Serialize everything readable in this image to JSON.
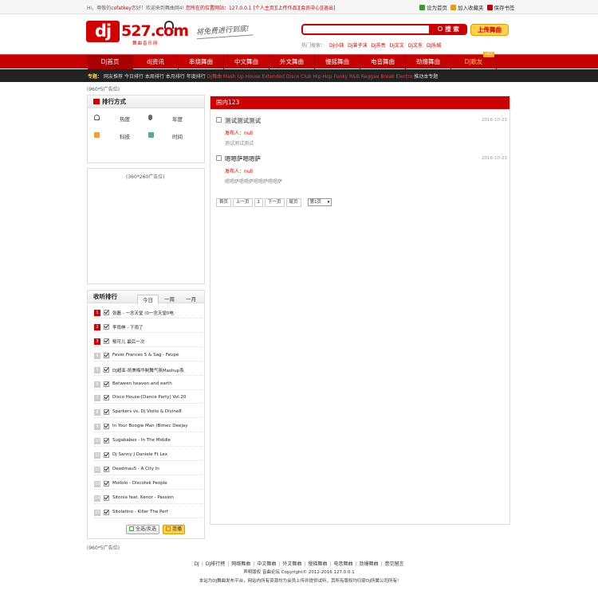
{
  "topbar": {
    "greeting_prefix": "Hi，",
    "greeting_mid": "尊敬的",
    "username": "cofatkey",
    "welcome": "您好！欢迎来到舞曲网4!",
    "site_url_label": "您所在的位置网站：127.0.0.1",
    "links": [
      "[个人主页]",
      "[上传作品]",
      "[会员中心]",
      "[退出]"
    ],
    "set_home": "设为首页",
    "add_fav": "加入收藏夹",
    "save_desktop": "保存书签",
    "icon_colors": [
      "#3a9a2a",
      "#e8a000",
      "#c00000"
    ]
  },
  "header": {
    "logo_dj": "dj",
    "logo_num": "527.com",
    "logo_sub": "舞曲音乐网",
    "slogan": "将免费进行到底!",
    "search_placeholder": "",
    "search_button": "搜 索",
    "upload_button": "上传舞曲",
    "hot_label": "热门搜索：",
    "hot_keywords": [
      "Dj小钰",
      "Dj曾子沫",
      "Dj苏亮",
      "Dj文文",
      "Dj文东",
      "Dj乐城"
    ]
  },
  "nav": {
    "items": [
      "Dj首页",
      "dj资讯",
      "串烧舞曲",
      "中文舞曲",
      "外文舞曲",
      "慢摇舞曲",
      "电音舞曲",
      "劲爆舞曲",
      "Dj歌友"
    ],
    "hot_badge": "HOT",
    "accent": "#c40000"
  },
  "subnav": {
    "label": "专题：",
    "links": [
      "网友推荐",
      "今日排行",
      "本周排行",
      "本月排行",
      "年度排行"
    ],
    "genres": "DJ舞曲 Mash Up House Extended Disco Club Hip-Hop Funky R&B Reggae Break Electro",
    "more": "推动本专题"
  },
  "ads": {
    "top": "(960*5广告位)",
    "side": "(360*260广告位)",
    "bottom": "(960*5广告位)"
  },
  "rank_mode": {
    "title": "排行方式",
    "cells": [
      "热度",
      "年度",
      "科技",
      "时间"
    ],
    "icon_names": [
      "headphone-icon",
      "mic-icon",
      "note-icon",
      "user-icon"
    ]
  },
  "listen_rank": {
    "title": "收听排行",
    "tabs": [
      "今日",
      "一周",
      "一月"
    ],
    "items": [
      {
        "n": "1",
        "title": "张磊 - 一念天堂 (0一念天堂0电"
      },
      {
        "n": "2",
        "title": "李雨伸 - 下雨了"
      },
      {
        "n": "3",
        "title": "郁可儿 最后一次"
      },
      {
        "n": "4",
        "title": "Fever Frances 5 & Sag - Fevpe"
      },
      {
        "n": "5",
        "title": "DJ超亚-凯美梅华制舞气氛Mashup系"
      },
      {
        "n": "6",
        "title": "Between heaven and earth"
      },
      {
        "n": "7",
        "title": "Disco House-[Dance Party] Vol.20"
      },
      {
        "n": "8",
        "title": "Sparkers vs. Dj Visito & Divine8"
      },
      {
        "n": "9",
        "title": "In Your Boogie Man (Bimec Deejay"
      },
      {
        "n": "10",
        "title": "Sugababes - In The Middle"
      },
      {
        "n": "11",
        "title": "Dj Sanny J Daniele Ft Lex"
      },
      {
        "n": "12",
        "title": "Deadmau5 - A City In"
      },
      {
        "n": "13",
        "title": "Mollolo - Discotek People"
      },
      {
        "n": "14",
        "title": "Sitonia feat. Kenor - Passion"
      },
      {
        "n": "15",
        "title": "Sitolatino - Killer The Perf"
      }
    ],
    "select_all": "全选/反选",
    "play": "连播"
  },
  "main": {
    "title": "国内123",
    "author_label": "发布人：",
    "articles": [
      {
        "title": "测试测试测试",
        "date": "2016-10-23",
        "author": "null",
        "summary": "测试测试测试"
      },
      {
        "title": "嗯嗯萨嗯嗯萨",
        "date": "2016-10-23",
        "author": "null",
        "summary": "嗯嗯萨嗯嗯萨嗯嗯萨嗯嗯萨"
      }
    ],
    "pager": [
      "首页",
      "上一页",
      "1",
      "下一页",
      "尾页"
    ],
    "page_select": "第1页"
  },
  "footer": {
    "links": [
      "DJ",
      "DJ排行榜",
      "网络舞曲",
      "中文舞曲",
      "外文舞曲",
      "慢摇舞曲",
      "电音舞曲",
      "劲爆舞曲",
      "意见留言"
    ],
    "copyright": "声明版权 音曲论坛 Copyright© 2012-2016 127.0.0.1",
    "note": "本站为DJ舞曲发布平台，网站内所有资源均为会员上传并提供试听，其所有版权均归原DJ所属公司所有!"
  }
}
